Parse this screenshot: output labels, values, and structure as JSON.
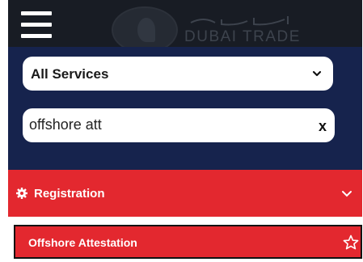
{
  "header": {
    "logo_text": "DUBAI TRADE",
    "logo_arabic": "دبي التجارية",
    "icons": [
      "menu-icon",
      "logo-icon"
    ]
  },
  "filters": {
    "service_select_value": "All Services",
    "search_value": "offshore att",
    "clear_label": "x"
  },
  "category": {
    "label": "Registration",
    "icon": "gear-icon",
    "expand_icon": "chevron-down-icon"
  },
  "results": [
    {
      "label": "Offshore Attestation",
      "icon": "star-icon"
    }
  ],
  "colors": {
    "header_bg": "#181c24",
    "panel_bg": "#16234d",
    "accent_red": "#e3282f",
    "text_white": "#ffffff"
  }
}
